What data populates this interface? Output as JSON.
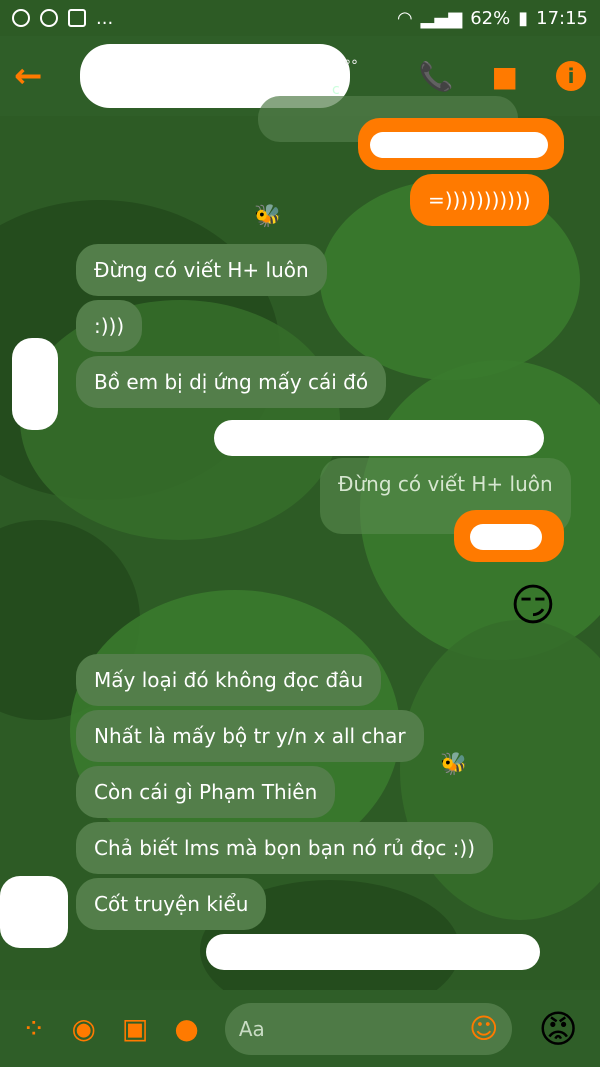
{
  "status_bar": {
    "dots": "...",
    "battery": "62%",
    "time": "17:15"
  },
  "header": {
    "back_icon": "←",
    "subtitle_fragment": "c",
    "call_icon": "📞",
    "video_icon": "■",
    "info_icon": "i"
  },
  "messages": {
    "sent_1": "=)))))))))))",
    "recv_1": "Đừng có viết H+ luôn",
    "recv_2": ":)))",
    "recv_3": "Bồ em bị dị ứng mấy cái đó",
    "reply_quote": "Đừng có viết H+ luôn",
    "emoji_smirk": "😏",
    "recv_4": "Mấy loại đó không đọc đâu",
    "recv_5": "Nhất là mấy bộ tr y/n x all char",
    "recv_6": "Còn cái gì Phạm Thiên",
    "recv_7": "Chả biết lms mà bọn bạn nó rủ đọc :))",
    "recv_8": "Cốt truyện kiểu"
  },
  "composer": {
    "placeholder": "Aa",
    "emoji_button": "☺",
    "reaction_emoji": "😡"
  },
  "colors": {
    "accent": "#ff7a00",
    "received_bubble": "#537e4a",
    "background": "#2d5b25"
  }
}
